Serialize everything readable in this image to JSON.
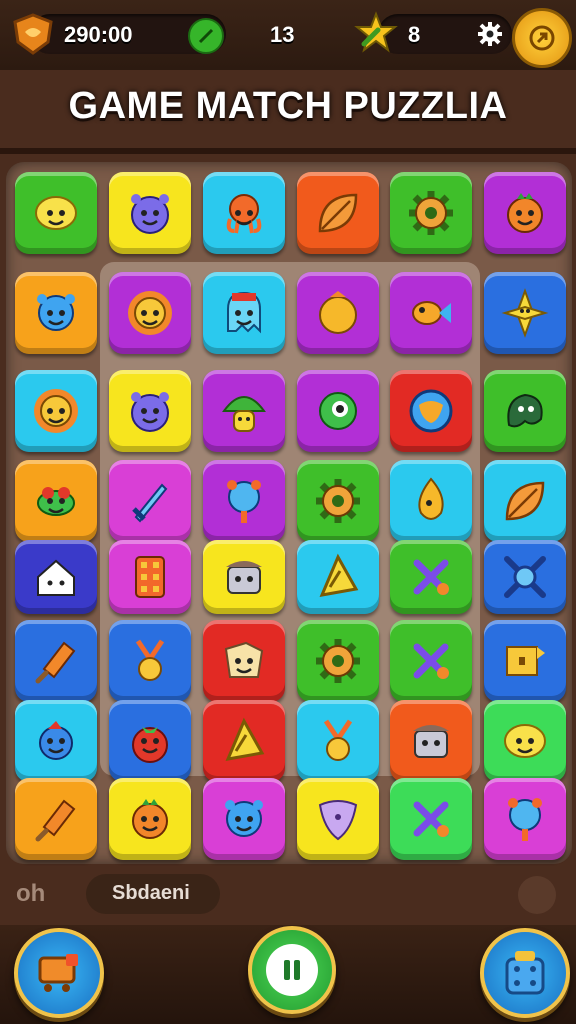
{
  "hud": {
    "score": "290:00",
    "moves": "13",
    "stars": "8"
  },
  "title": "GAME MATCH PUZZLIA",
  "footer": {
    "left_label": "oh",
    "right_label": "Sbdaeni"
  },
  "colors": {
    "green": "#3fbf2a",
    "yellow": "#f7e51e",
    "cyan": "#2bc9ee",
    "orange_red": "#f15a1c",
    "purple": "#b22fd6",
    "orange": "#f7a21b",
    "blue": "#2a6fe0",
    "red": "#e22a24",
    "navy": "#3a3ac9",
    "magenta": "#d93fd6",
    "lime": "#3ddc58"
  },
  "board": {
    "rows": [
      [
        {
          "color": "green",
          "icon": "smiley-icon"
        },
        {
          "color": "yellow",
          "icon": "purple-monster-icon"
        },
        {
          "color": "cyan",
          "icon": "octopus-icon"
        },
        {
          "color": "orange_red",
          "icon": "leaf-icon"
        },
        {
          "color": "green",
          "icon": "gear-icon"
        },
        {
          "color": "purple",
          "icon": "orange-face-icon"
        }
      ],
      [
        {
          "color": "orange",
          "icon": "blue-face-icon"
        },
        {
          "color": "purple",
          "icon": "sun-icon"
        },
        {
          "color": "cyan",
          "icon": "ghost-icon"
        },
        {
          "color": "purple",
          "icon": "orange-ball-icon"
        },
        {
          "color": "purple",
          "icon": "fish-icon"
        },
        {
          "color": "blue",
          "icon": "star-diamond-icon"
        }
      ],
      [
        {
          "color": "cyan",
          "icon": "sun-icon"
        },
        {
          "color": "yellow",
          "icon": "purple-monster-icon"
        },
        {
          "color": "purple",
          "icon": "mushroom-icon"
        },
        {
          "color": "purple",
          "icon": "green-monster-icon"
        },
        {
          "color": "red",
          "icon": "globe-icon"
        },
        {
          "color": "green",
          "icon": "blob-icon"
        }
      ],
      [
        {
          "color": "orange",
          "icon": "turtle-icon"
        },
        {
          "color": "magenta",
          "icon": "sword-icon"
        },
        {
          "color": "purple",
          "icon": "bear-pop-icon"
        },
        {
          "color": "green",
          "icon": "gear-icon"
        },
        {
          "color": "cyan",
          "icon": "flame-icon"
        },
        {
          "color": "cyan",
          "icon": "leaf-icon"
        }
      ],
      [
        {
          "color": "navy",
          "icon": "house-icon"
        },
        {
          "color": "magenta",
          "icon": "domino-icon"
        },
        {
          "color": "yellow",
          "icon": "robot-icon"
        },
        {
          "color": "cyan",
          "icon": "triangle-icon"
        },
        {
          "color": "green",
          "icon": "cross-icon"
        },
        {
          "color": "blue",
          "icon": "target-icon"
        }
      ],
      [
        {
          "color": "blue",
          "icon": "popsicle-icon"
        },
        {
          "color": "blue",
          "icon": "medal-icon"
        },
        {
          "color": "red",
          "icon": "cheese-icon"
        },
        {
          "color": "green",
          "icon": "gear-icon"
        },
        {
          "color": "green",
          "icon": "cross-icon"
        },
        {
          "color": "blue",
          "icon": "flag-icon"
        }
      ],
      [
        {
          "color": "cyan",
          "icon": "bird-icon"
        },
        {
          "color": "blue",
          "icon": "tomato-icon"
        },
        {
          "color": "red",
          "icon": "triangle-icon"
        },
        {
          "color": "cyan",
          "icon": "medal-icon"
        },
        {
          "color": "orange_red",
          "icon": "robot-icon"
        },
        {
          "color": "lime",
          "icon": "smiley-icon"
        }
      ],
      [
        {
          "color": "orange",
          "icon": "popsicle-icon"
        },
        {
          "color": "yellow",
          "icon": "orange-face-icon"
        },
        {
          "color": "magenta",
          "icon": "blue-face-icon"
        },
        {
          "color": "yellow",
          "icon": "shield-icon"
        },
        {
          "color": "lime",
          "icon": "cross-icon"
        },
        {
          "color": "magenta",
          "icon": "bear-pop-icon"
        }
      ]
    ]
  }
}
